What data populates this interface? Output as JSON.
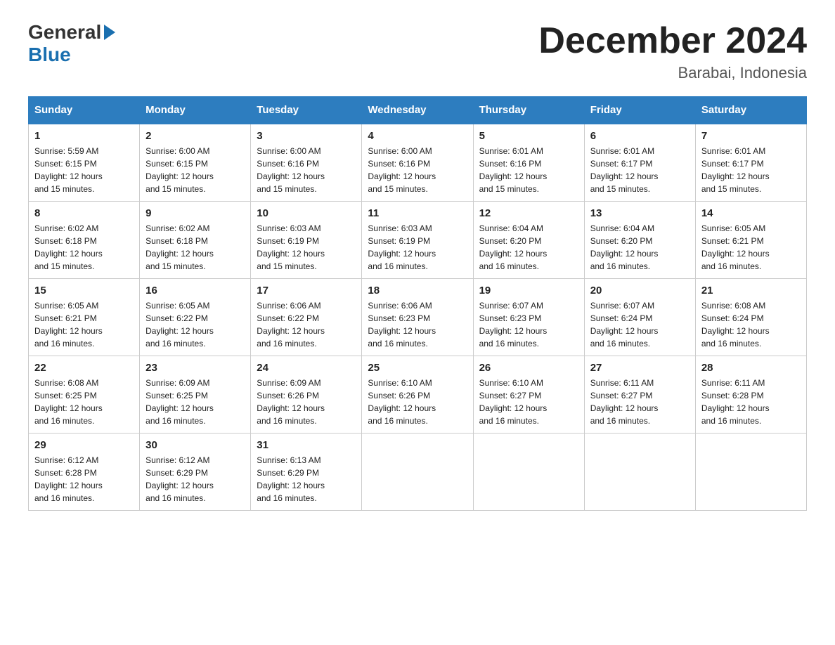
{
  "header": {
    "logo_general": "General",
    "logo_blue": "Blue",
    "title": "December 2024",
    "subtitle": "Barabai, Indonesia"
  },
  "days_of_week": [
    "Sunday",
    "Monday",
    "Tuesday",
    "Wednesday",
    "Thursday",
    "Friday",
    "Saturday"
  ],
  "weeks": [
    [
      {
        "day": "1",
        "sunrise": "5:59 AM",
        "sunset": "6:15 PM",
        "daylight": "12 hours and 15 minutes."
      },
      {
        "day": "2",
        "sunrise": "6:00 AM",
        "sunset": "6:15 PM",
        "daylight": "12 hours and 15 minutes."
      },
      {
        "day": "3",
        "sunrise": "6:00 AM",
        "sunset": "6:16 PM",
        "daylight": "12 hours and 15 minutes."
      },
      {
        "day": "4",
        "sunrise": "6:00 AM",
        "sunset": "6:16 PM",
        "daylight": "12 hours and 15 minutes."
      },
      {
        "day": "5",
        "sunrise": "6:01 AM",
        "sunset": "6:16 PM",
        "daylight": "12 hours and 15 minutes."
      },
      {
        "day": "6",
        "sunrise": "6:01 AM",
        "sunset": "6:17 PM",
        "daylight": "12 hours and 15 minutes."
      },
      {
        "day": "7",
        "sunrise": "6:01 AM",
        "sunset": "6:17 PM",
        "daylight": "12 hours and 15 minutes."
      }
    ],
    [
      {
        "day": "8",
        "sunrise": "6:02 AM",
        "sunset": "6:18 PM",
        "daylight": "12 hours and 15 minutes."
      },
      {
        "day": "9",
        "sunrise": "6:02 AM",
        "sunset": "6:18 PM",
        "daylight": "12 hours and 15 minutes."
      },
      {
        "day": "10",
        "sunrise": "6:03 AM",
        "sunset": "6:19 PM",
        "daylight": "12 hours and 15 minutes."
      },
      {
        "day": "11",
        "sunrise": "6:03 AM",
        "sunset": "6:19 PM",
        "daylight": "12 hours and 16 minutes."
      },
      {
        "day": "12",
        "sunrise": "6:04 AM",
        "sunset": "6:20 PM",
        "daylight": "12 hours and 16 minutes."
      },
      {
        "day": "13",
        "sunrise": "6:04 AM",
        "sunset": "6:20 PM",
        "daylight": "12 hours and 16 minutes."
      },
      {
        "day": "14",
        "sunrise": "6:05 AM",
        "sunset": "6:21 PM",
        "daylight": "12 hours and 16 minutes."
      }
    ],
    [
      {
        "day": "15",
        "sunrise": "6:05 AM",
        "sunset": "6:21 PM",
        "daylight": "12 hours and 16 minutes."
      },
      {
        "day": "16",
        "sunrise": "6:05 AM",
        "sunset": "6:22 PM",
        "daylight": "12 hours and 16 minutes."
      },
      {
        "day": "17",
        "sunrise": "6:06 AM",
        "sunset": "6:22 PM",
        "daylight": "12 hours and 16 minutes."
      },
      {
        "day": "18",
        "sunrise": "6:06 AM",
        "sunset": "6:23 PM",
        "daylight": "12 hours and 16 minutes."
      },
      {
        "day": "19",
        "sunrise": "6:07 AM",
        "sunset": "6:23 PM",
        "daylight": "12 hours and 16 minutes."
      },
      {
        "day": "20",
        "sunrise": "6:07 AM",
        "sunset": "6:24 PM",
        "daylight": "12 hours and 16 minutes."
      },
      {
        "day": "21",
        "sunrise": "6:08 AM",
        "sunset": "6:24 PM",
        "daylight": "12 hours and 16 minutes."
      }
    ],
    [
      {
        "day": "22",
        "sunrise": "6:08 AM",
        "sunset": "6:25 PM",
        "daylight": "12 hours and 16 minutes."
      },
      {
        "day": "23",
        "sunrise": "6:09 AM",
        "sunset": "6:25 PM",
        "daylight": "12 hours and 16 minutes."
      },
      {
        "day": "24",
        "sunrise": "6:09 AM",
        "sunset": "6:26 PM",
        "daylight": "12 hours and 16 minutes."
      },
      {
        "day": "25",
        "sunrise": "6:10 AM",
        "sunset": "6:26 PM",
        "daylight": "12 hours and 16 minutes."
      },
      {
        "day": "26",
        "sunrise": "6:10 AM",
        "sunset": "6:27 PM",
        "daylight": "12 hours and 16 minutes."
      },
      {
        "day": "27",
        "sunrise": "6:11 AM",
        "sunset": "6:27 PM",
        "daylight": "12 hours and 16 minutes."
      },
      {
        "day": "28",
        "sunrise": "6:11 AM",
        "sunset": "6:28 PM",
        "daylight": "12 hours and 16 minutes."
      }
    ],
    [
      {
        "day": "29",
        "sunrise": "6:12 AM",
        "sunset": "6:28 PM",
        "daylight": "12 hours and 16 minutes."
      },
      {
        "day": "30",
        "sunrise": "6:12 AM",
        "sunset": "6:29 PM",
        "daylight": "12 hours and 16 minutes."
      },
      {
        "day": "31",
        "sunrise": "6:13 AM",
        "sunset": "6:29 PM",
        "daylight": "12 hours and 16 minutes."
      },
      null,
      null,
      null,
      null
    ]
  ],
  "labels": {
    "sunrise": "Sunrise:",
    "sunset": "Sunset:",
    "daylight": "Daylight:"
  }
}
